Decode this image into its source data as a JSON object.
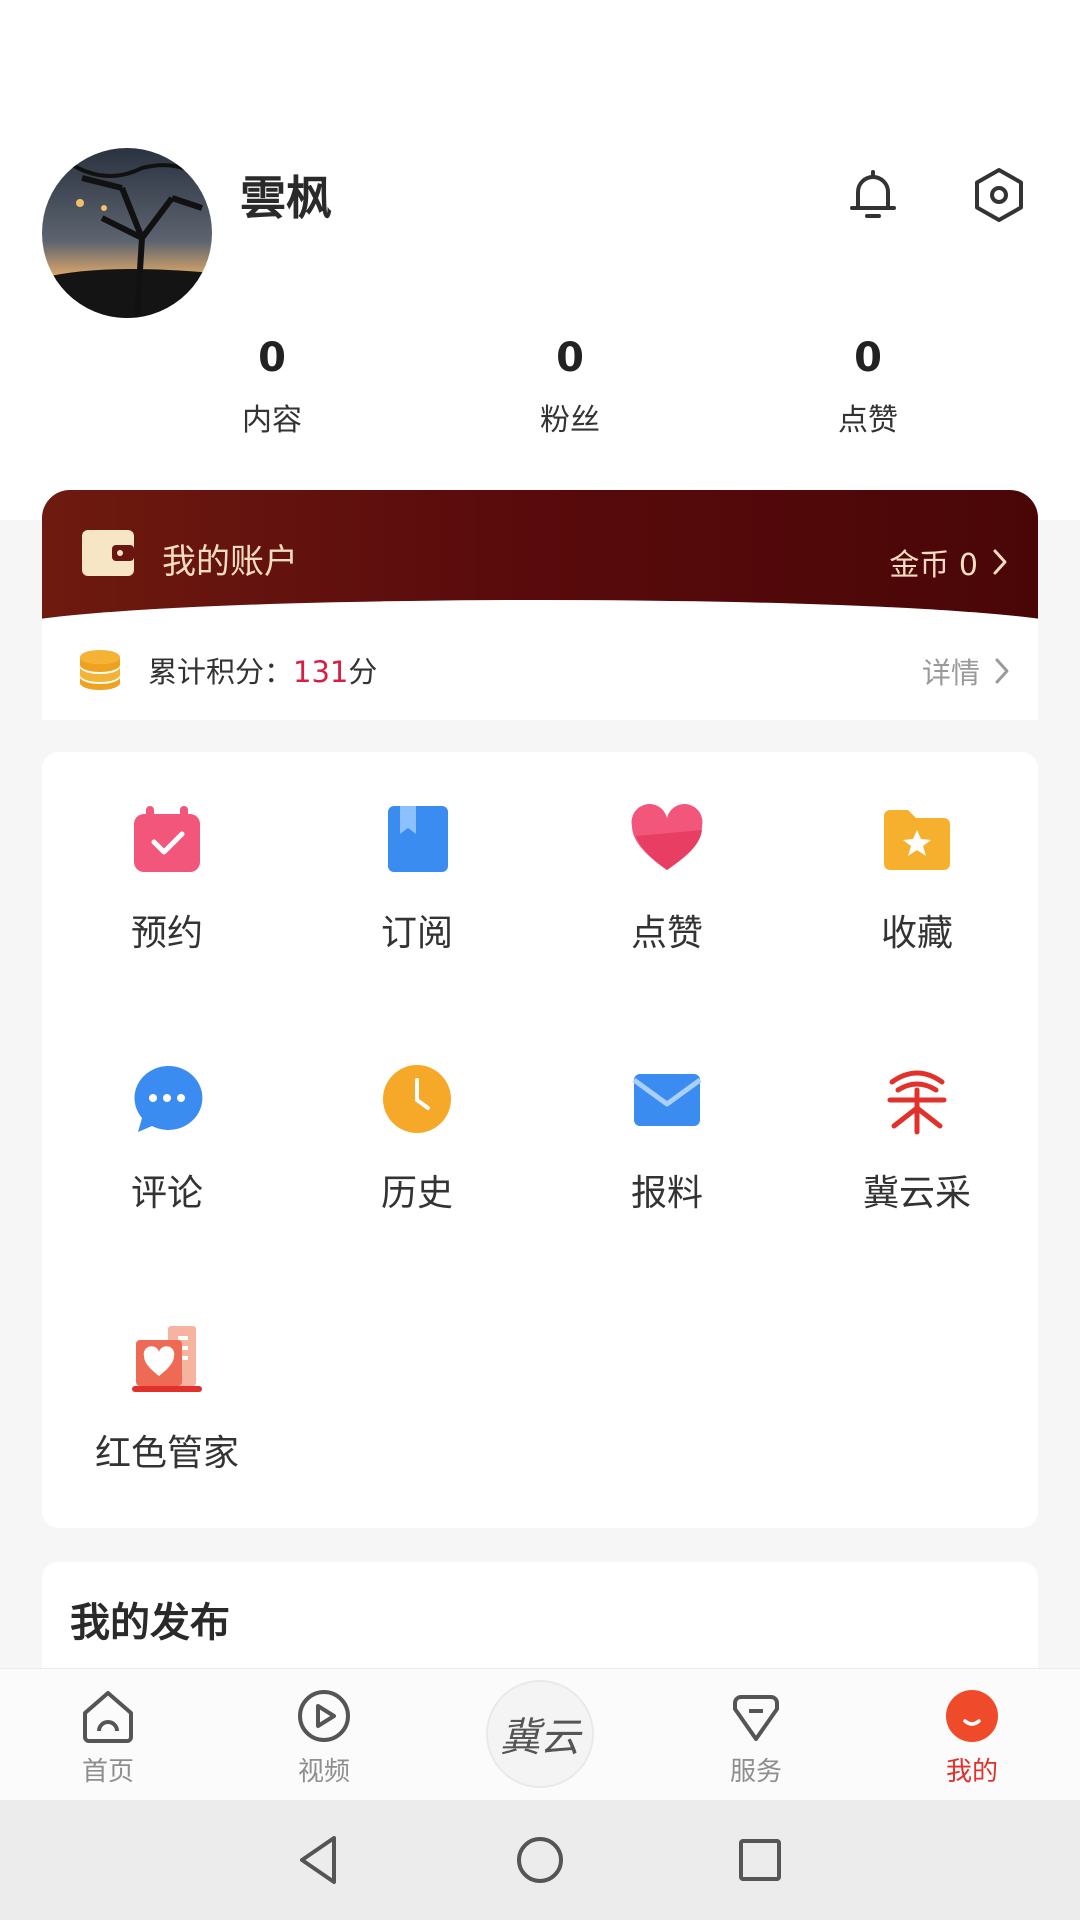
{
  "profile": {
    "username": "雲枫",
    "stats": [
      {
        "value": "0",
        "label": "内容"
      },
      {
        "value": "0",
        "label": "粉丝"
      },
      {
        "value": "0",
        "label": "点赞"
      }
    ]
  },
  "account": {
    "title": "我的账户",
    "coins_label": "金币 0"
  },
  "points": {
    "prefix": "累计积分：",
    "value": "131",
    "suffix": "分",
    "details": "详情"
  },
  "grid": [
    {
      "label": "预约",
      "icon": "calendar-check-icon"
    },
    {
      "label": "订阅",
      "icon": "bookmark-book-icon"
    },
    {
      "label": "点赞",
      "icon": "heart-icon"
    },
    {
      "label": "收藏",
      "icon": "star-folder-icon"
    },
    {
      "label": "评论",
      "icon": "chat-bubble-icon"
    },
    {
      "label": "历史",
      "icon": "clock-icon"
    },
    {
      "label": "报料",
      "icon": "envelope-icon"
    },
    {
      "label": "冀云采",
      "icon": "jiyuncai-logo-icon"
    },
    {
      "label": "红色管家",
      "icon": "red-butler-icon"
    }
  ],
  "publications": {
    "title": "我的发布"
  },
  "tabbar": {
    "tabs": [
      {
        "label": "首页",
        "icon": "home-icon"
      },
      {
        "label": "视频",
        "icon": "play-icon"
      },
      {
        "label": "服务",
        "icon": "diamond-tag-icon"
      },
      {
        "label": "我的",
        "icon": "me-icon"
      }
    ],
    "center_logo": "冀云",
    "active": "我的"
  },
  "colors": {
    "accent": "#e2302a",
    "points_value": "#d81e45",
    "account_gradient_start": "#6e1a0f",
    "account_gradient_end": "#4a0607",
    "account_text": "#f4dcc0"
  }
}
